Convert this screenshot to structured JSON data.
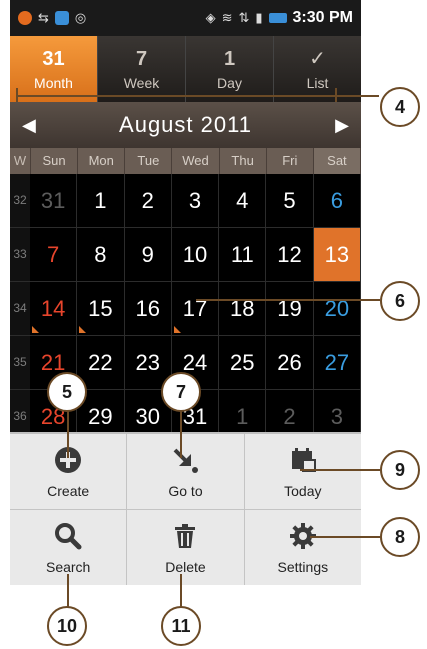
{
  "status_bar": {
    "time": "3:30 PM"
  },
  "tabs": [
    {
      "icon": "31",
      "label": "Month",
      "active": true
    },
    {
      "icon": "7",
      "label": "Week"
    },
    {
      "icon": "1",
      "label": "Day"
    },
    {
      "icon": "✓",
      "label": "List"
    }
  ],
  "month_header": {
    "title": "August  2011"
  },
  "day_headers": {
    "week": "W",
    "days": [
      "Sun",
      "Mon",
      "Tue",
      "Wed",
      "Thu",
      "Fri",
      "Sat"
    ]
  },
  "weeks": [
    {
      "num": "32",
      "days": [
        "31",
        "1",
        "2",
        "3",
        "4",
        "5",
        "6"
      ]
    },
    {
      "num": "33",
      "days": [
        "7",
        "8",
        "9",
        "10",
        "11",
        "12",
        "13"
      ]
    },
    {
      "num": "34",
      "days": [
        "14",
        "15",
        "16",
        "17",
        "18",
        "19",
        "20"
      ]
    },
    {
      "num": "35",
      "days": [
        "21",
        "22",
        "23",
        "24",
        "25",
        "26",
        "27"
      ]
    },
    {
      "num": "36",
      "days": [
        "28",
        "29",
        "30",
        "31",
        "1",
        "2",
        "3"
      ]
    }
  ],
  "menu": {
    "create": "Create",
    "goto": "Go to",
    "today": "Today",
    "search": "Search",
    "delete": "Delete",
    "settings": "Settings"
  },
  "callouts": {
    "c4": "4",
    "c5": "5",
    "c6": "6",
    "c7": "7",
    "c8": "8",
    "c9": "9",
    "c10": "10",
    "c11": "11"
  },
  "colors": {
    "accent": "#e0732a",
    "sunday": "#e8452c",
    "saturday": "#3a9de0",
    "callout_border": "#6b4a26"
  }
}
